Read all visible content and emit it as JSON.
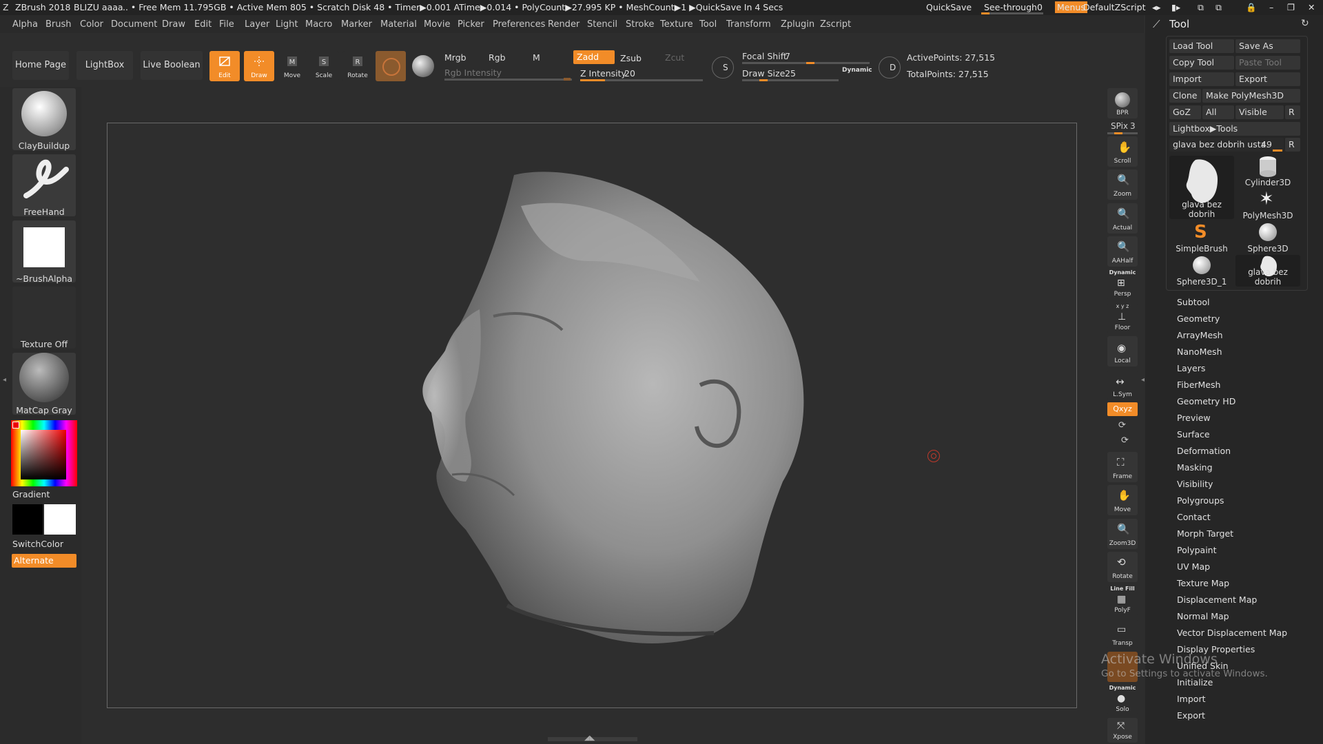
{
  "titlebar": {
    "app": "ZBrush 2018",
    "doc": "BLIZU aaaa",
    "stats": ".. • Free Mem 11.795GB • Active Mem 805 • Scratch Disk 48 • Timer▶0.001 ATime▶0.014 • PolyCount▶27.995 KP • MeshCount▶1 ▶QuickSave In 4 Secs",
    "quicksave": "QuickSave",
    "seethrough": "See-through",
    "seethrough_value": "0",
    "menus": "Menus",
    "defaultzscript": "DefaultZScript"
  },
  "menu": [
    "Alpha",
    "Brush",
    "Color",
    "Document",
    "Draw",
    "Edit",
    "File",
    "Layer",
    "Light",
    "Macro",
    "Marker",
    "Material",
    "Movie",
    "Picker",
    "Preferences",
    "Render",
    "Stencil",
    "Stroke",
    "Texture",
    "Tool",
    "Transform",
    "Zplugin",
    "Zscript"
  ],
  "shelf": {
    "home_page": "Home Page",
    "lightbox": "LightBox",
    "live_boolean": "Live Boolean",
    "edit": "Edit",
    "draw": "Draw",
    "move": "Move",
    "scale": "Scale",
    "rotate": "Rotate",
    "mrgb": "Mrgb",
    "rgb": "Rgb",
    "m": "M",
    "rgb_intensity": "Rgb Intensity",
    "zadd": "Zadd",
    "zsub": "Zsub",
    "zcut": "Zcut",
    "z_intensity_label": "Z Intensity",
    "z_intensity": "20",
    "z_intensity_level": 0.2,
    "focal_shift_label": "Focal Shift",
    "focal_shift": "7",
    "focal_shift_level": 0.535,
    "draw_size_label": "Draw Size",
    "draw_size": "25",
    "draw_size_level": 0.02,
    "dynamic": "Dynamic",
    "active_points": "ActivePoints: 27,515",
    "total_points": "TotalPoints: 27,515"
  },
  "left": {
    "brush": "ClayBuildup",
    "stroke": "FreeHand",
    "alpha": "~BrushAlpha",
    "texture": "Texture Off",
    "material": "MatCap Gray",
    "gradient": "Gradient",
    "switchcolor": "SwitchColor",
    "alternate": "Alternate"
  },
  "righttools": {
    "bpr": "BPR",
    "spix_label": "SPix",
    "spix": "3",
    "scroll": "Scroll",
    "zoom": "Zoom",
    "actual": "Actual",
    "aahalf": "AAHalf",
    "dynamic": "Dynamic",
    "persp": "Persp",
    "xyz_small": "x y z",
    "floor": "Floor",
    "local": "Local",
    "lsym": "L.Sym",
    "xyz": "Qxyz",
    "frame": "Frame",
    "move": "Move",
    "zoom3d": "Zoom3D",
    "rotate": "Rotate",
    "linefill": "Line Fill",
    "polyf": "PolyF",
    "transp": "Transp",
    "dynamic2": "Dynamic",
    "solo": "Solo",
    "xpose": "Xpose"
  },
  "tool": {
    "title": "Tool",
    "load_tool": "Load Tool",
    "save_as": "Save As",
    "copy_tool": "Copy Tool",
    "paste_tool": "Paste Tool",
    "import": "Import",
    "export": "Export",
    "clone": "Clone",
    "make_polymesh": "Make PolyMesh3D",
    "goz": "GoZ",
    "all": "All",
    "visible": "Visible",
    "r": "R",
    "lightbox_tools": "Lightbox▶Tools",
    "current_tool": "glava bez dobrih usta.",
    "current_value": "49",
    "thumbs": [
      "glava bez dobrih",
      "Cylinder3D",
      "PolyMesh3D",
      "SimpleBrush",
      "Sphere3D",
      "Sphere3D_1",
      "glava bez dobrih"
    ],
    "subpalettes": [
      "Subtool",
      "Geometry",
      "ArrayMesh",
      "NanoMesh",
      "Layers",
      "FiberMesh",
      "Geometry HD",
      "Preview",
      "Surface",
      "Deformation",
      "Masking",
      "Visibility",
      "Polygroups",
      "Contact",
      "Morph Target",
      "Polypaint",
      "UV Map",
      "Texture Map",
      "Displacement Map",
      "Normal Map",
      "Vector Displacement Map",
      "Display Properties",
      "Unified Skin",
      "Initialize",
      "Import",
      "Export"
    ]
  },
  "watermark": {
    "line1": "Activate Windows",
    "line2": "Go to Settings to activate Windows."
  },
  "colors": {
    "accent": "#f28c28",
    "bg": "#2d2d2d",
    "panel": "#262626"
  }
}
